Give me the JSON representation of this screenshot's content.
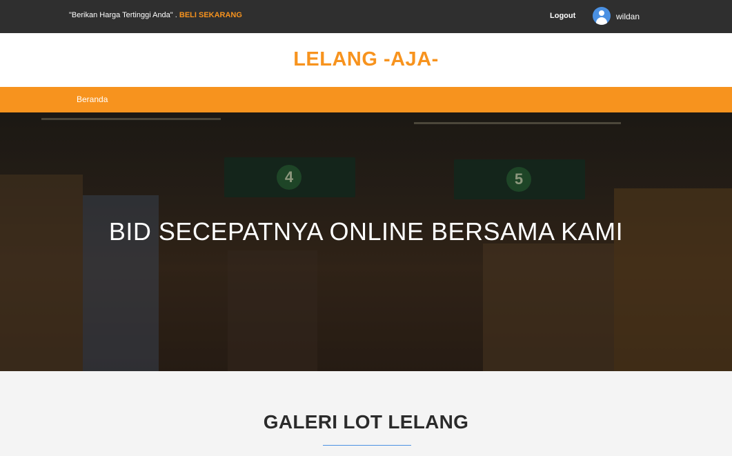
{
  "topbar": {
    "tagline": "\"Berikan Harga Tertinggi Anda\"",
    "separator": " . ",
    "cta_label": "BELI SEKARANG",
    "logout_label": "Logout",
    "username": "wildan",
    "avatar_icon": "user-avatar-icon"
  },
  "brand": {
    "title": "LELANG -AJA-"
  },
  "nav": {
    "items": [
      {
        "label": "Beranda"
      }
    ]
  },
  "hero": {
    "title": "BID SECEPATNYA ONLINE BERSAMA KAMI"
  },
  "gallery": {
    "title": "GALERI LOT LELANG"
  },
  "colors": {
    "accent": "#f7931e",
    "topbar_bg": "#2f2f2f",
    "link_blue": "#4a90e2"
  }
}
